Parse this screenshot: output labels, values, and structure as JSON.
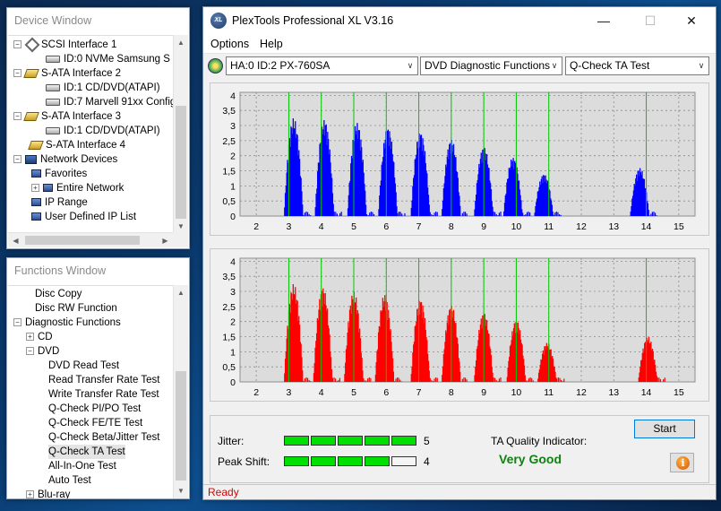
{
  "device_window": {
    "title": "Device Window",
    "items": [
      {
        "label": "SCSI Interface 1",
        "expander": "−",
        "icon": "scsi-icon"
      },
      {
        "label": "ID:0  NVMe     Samsung S",
        "icon": "disk-icon"
      },
      {
        "label": "S-ATA Interface 2",
        "expander": "−",
        "icon": "sata-icon"
      },
      {
        "label": "ID:1  CD/DVD(ATAPI)",
        "icon": "disk-icon"
      },
      {
        "label": "ID:7  Marvell 91xx Config",
        "icon": "disk-icon"
      },
      {
        "label": "S-ATA Interface 3",
        "expander": "−",
        "icon": "sata-icon"
      },
      {
        "label": "ID:1  CD/DVD(ATAPI)",
        "icon": "disk-icon"
      },
      {
        "label": "S-ATA Interface 4",
        "icon": "sata-icon"
      },
      {
        "label": "Network Devices",
        "expander": "−",
        "icon": "network-icon"
      },
      {
        "label": "Favorites",
        "icon": "computer-icon"
      },
      {
        "label": "Entire Network",
        "expander": "+",
        "icon": "computer-icon"
      },
      {
        "label": "IP Range",
        "icon": "computer-icon"
      },
      {
        "label": "User Defined IP List",
        "icon": "computer-icon"
      }
    ]
  },
  "functions_window": {
    "title": "Functions Window",
    "items": [
      {
        "label": "Disc Copy",
        "expander": ""
      },
      {
        "label": "Disc RW Function",
        "expander": ""
      },
      {
        "label": "Diagnostic Functions",
        "expander": "−"
      },
      {
        "label": "CD",
        "expander": "+"
      },
      {
        "label": "DVD",
        "expander": "−"
      },
      {
        "label": "DVD Read Test",
        "expander": ""
      },
      {
        "label": "Read Transfer Rate Test",
        "expander": ""
      },
      {
        "label": "Write Transfer Rate Test",
        "expander": ""
      },
      {
        "label": "Q-Check PI/PO Test",
        "expander": ""
      },
      {
        "label": "Q-Check FE/TE Test",
        "expander": ""
      },
      {
        "label": "Q-Check Beta/Jitter Test",
        "expander": ""
      },
      {
        "label": "Q-Check TA Test",
        "expander": "",
        "selected": true
      },
      {
        "label": "All-In-One Test",
        "expander": ""
      },
      {
        "label": "Auto Test",
        "expander": ""
      },
      {
        "label": "Blu-ray",
        "expander": "+"
      }
    ]
  },
  "main": {
    "title": "PlexTools Professional XL V3.16",
    "logo_text": "XL",
    "menu": [
      "Options",
      "Help"
    ],
    "drive_select": "HA:0 ID:2  PX-760SA",
    "function_select": "DVD Diagnostic Functions",
    "test_select": "Q-Check TA Test",
    "jitter_label": "Jitter:",
    "jitter_value": "5",
    "peak_shift_label": "Peak Shift:",
    "peak_shift_value": "4",
    "ta_quality_label": "TA Quality Indicator:",
    "ta_quality_value": "Very Good",
    "start_label": "Start",
    "status": "Ready",
    "colors": {
      "top_series": "#0000ff",
      "bottom_series": "#ff0000",
      "marker_lines": "#00c800",
      "quality_text": "#108010"
    }
  },
  "chart_data": [
    {
      "type": "area",
      "series": [
        {
          "color": "#0000ff",
          "peaks": [
            {
              "x": 3.15,
              "y": 3.25
            },
            {
              "x": 4.1,
              "y": 3.2
            },
            {
              "x": 5.1,
              "y": 3.1
            },
            {
              "x": 6.05,
              "y": 2.95
            },
            {
              "x": 7.05,
              "y": 2.8
            },
            {
              "x": 8.0,
              "y": 2.55
            },
            {
              "x": 9.0,
              "y": 2.3
            },
            {
              "x": 9.9,
              "y": 1.95
            },
            {
              "x": 10.85,
              "y": 1.4
            },
            {
              "x": 13.8,
              "y": 1.6
            }
          ]
        }
      ],
      "markers": [
        3,
        4,
        5,
        6,
        7,
        8,
        9,
        10,
        11,
        14
      ],
      "x_ticks": [
        "2",
        "3",
        "4",
        "5",
        "6",
        "7",
        "8",
        "9",
        "10",
        "11",
        "12",
        "13",
        "14",
        "15"
      ],
      "y_ticks": [
        "0",
        "0,5",
        "1",
        "1,5",
        "2",
        "2,5",
        "3",
        "3,5",
        "4"
      ],
      "xlim": [
        1.5,
        15.5
      ],
      "ylim": [
        0,
        4.1
      ],
      "grid": true
    },
    {
      "type": "area",
      "series": [
        {
          "color": "#ff0000",
          "peaks": [
            {
              "x": 3.15,
              "y": 3.25
            },
            {
              "x": 4.05,
              "y": 3.15
            },
            {
              "x": 5.0,
              "y": 3.0
            },
            {
              "x": 5.95,
              "y": 2.9
            },
            {
              "x": 7.05,
              "y": 2.75
            },
            {
              "x": 8.0,
              "y": 2.55
            },
            {
              "x": 9.0,
              "y": 2.3
            },
            {
              "x": 10.0,
              "y": 2.05
            },
            {
              "x": 10.95,
              "y": 1.3
            },
            {
              "x": 14.05,
              "y": 1.5
            }
          ]
        }
      ],
      "markers": [
        3,
        4,
        5,
        6,
        7,
        8,
        9,
        10,
        11,
        14
      ],
      "x_ticks": [
        "2",
        "3",
        "4",
        "5",
        "6",
        "7",
        "8",
        "9",
        "10",
        "11",
        "12",
        "13",
        "14",
        "15"
      ],
      "y_ticks": [
        "0",
        "0,5",
        "1",
        "1,5",
        "2",
        "2,5",
        "3",
        "3,5",
        "4"
      ],
      "xlim": [
        1.5,
        15.5
      ],
      "ylim": [
        0,
        4.1
      ],
      "grid": true
    }
  ]
}
